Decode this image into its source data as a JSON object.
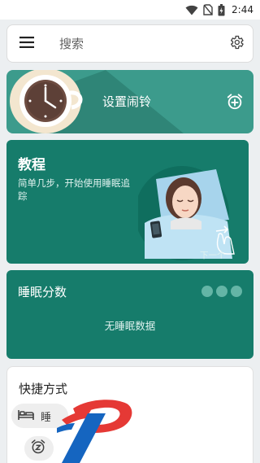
{
  "status_bar": {
    "time": "2:44"
  },
  "search": {
    "placeholder": "搜索"
  },
  "alarm_card": {
    "title": "设置闹铃"
  },
  "tutorial_card": {
    "title": "教程",
    "description": "简单几步，开始使用睡眠追踪",
    "next_label": "下一个"
  },
  "score_card": {
    "title": "睡眠分数",
    "empty_text": "无睡眠数据"
  },
  "shortcut_card": {
    "title": "快捷方式",
    "sleep_chip_label": "睡"
  },
  "colors": {
    "alarm_bg": "#3c9b8c",
    "card_bg": "#167c6b",
    "logo_red": "#e53935",
    "logo_blue": "#1565c0"
  },
  "icons": [
    "wifi-icon",
    "no-sim-icon",
    "battery-icon",
    "menu-icon",
    "gear-icon",
    "alarm-add-icon",
    "bed-icon",
    "alarm-snooze-icon"
  ]
}
